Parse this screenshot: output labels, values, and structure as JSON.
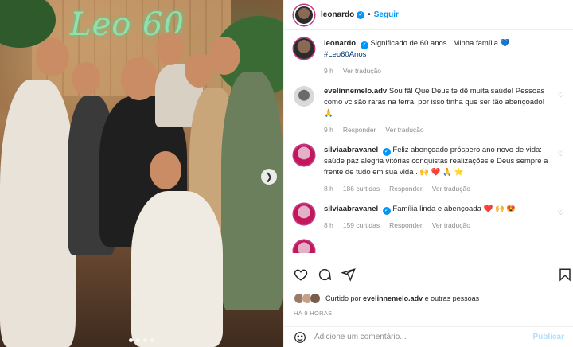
{
  "post": {
    "username": "leonardo",
    "follow_label": "Seguir",
    "separator": "•",
    "neon_sign": "Leo 60"
  },
  "comments": [
    {
      "username": "leonardo",
      "verified": true,
      "text": "Significado de 60 anos ! Minha família 💙",
      "hashtag": "#Leo60Anos",
      "time": "9 h",
      "action1": "Ver tradução",
      "action2": "",
      "action3": ""
    },
    {
      "username": "evelinnemelo.adv",
      "verified": false,
      "text": "Sou fã! Que Deus te dê muita saúde! Pessoas como vc são raras na terra, por isso tinha que ser tão abençoado! 🙏",
      "hashtag": "",
      "time": "9 h",
      "action1": "Responder",
      "action2": "Ver tradução",
      "action3": ""
    },
    {
      "username": "silviaabravanel",
      "verified": true,
      "text": "Feliz abençoado próspero ano novo de vida: saúde paz alegria vitórias conquistas realizações e Deus sempre a frente de tudo em sua vida . 🙌 ❤️ 🙏 ⭐",
      "hashtag": "",
      "time": "8 h",
      "action1": "186 curtidas",
      "action2": "Responder",
      "action3": "Ver tradução"
    },
    {
      "username": "silviaabravanel",
      "verified": true,
      "text": "Família linda e abençoada ❤️ 🙌 😍",
      "hashtag": "",
      "time": "8 h",
      "action1": "159 curtidas",
      "action2": "Responder",
      "action3": "Ver tradução"
    }
  ],
  "likes": {
    "prefix": "Curtido por",
    "user": "evelinnemelo.adv",
    "suffix": "e outras pessoas"
  },
  "date_label": "HÁ 9 HORAS",
  "add_comment": {
    "placeholder": "Adicione um comentário...",
    "publish_label": "Publicar"
  },
  "icons": {
    "like": "heart-icon",
    "comment": "comment-icon",
    "share": "share-icon",
    "save": "bookmark-icon",
    "next": "chevron-right-icon",
    "emoji": "emoji-icon"
  },
  "colors": {
    "link": "#0095f6",
    "verified": "#0095f6",
    "muted": "#8e8e8e",
    "hashtag": "#00376b"
  }
}
